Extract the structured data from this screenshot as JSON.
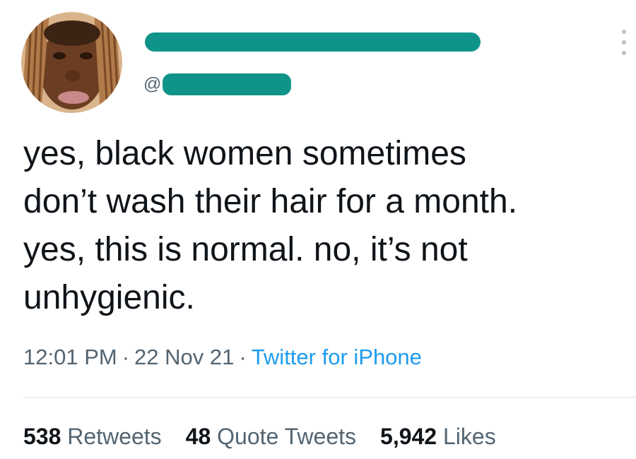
{
  "author": {
    "handle_prefix": "@"
  },
  "tweet": {
    "text": "yes, black women sometimes\ndon’t wash their hair for a month.\nyes, this is normal. no, it’s not\nunhygienic.",
    "time": "12:01 PM",
    "date": "22 Nov 21",
    "source": "Twitter for iPhone",
    "separator": "·"
  },
  "stats": {
    "retweets_count": "538",
    "retweets_label": "Retweets",
    "quotes_count": "48",
    "quotes_label": "Quote Tweets",
    "likes_count": "5,942",
    "likes_label": "Likes"
  },
  "colors": {
    "redaction": "#10948a",
    "link": "#1d9bf0",
    "secondary_text": "#536471"
  },
  "icons": {
    "more": "more-vertical-icon"
  }
}
